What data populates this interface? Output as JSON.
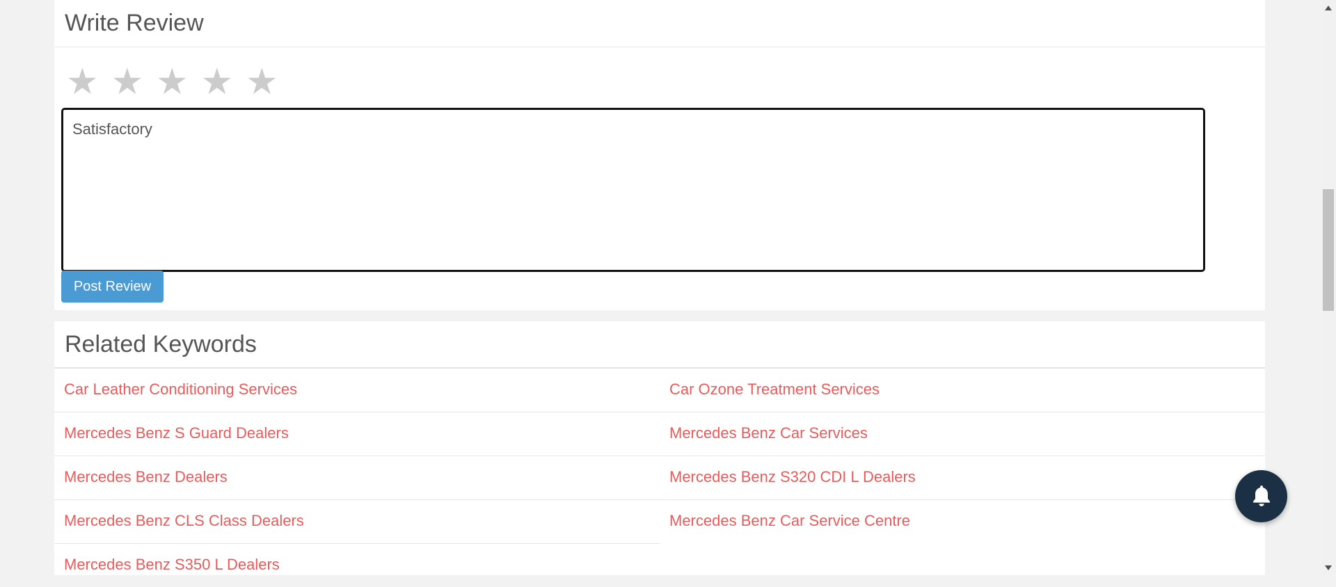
{
  "review": {
    "title": "Write Review",
    "rating": 0,
    "max_rating": 5,
    "star_glyph": "★",
    "text_placeholder": "Satisfactory",
    "post_label": "Post Review"
  },
  "keywords": {
    "title": "Related Keywords",
    "items": [
      "Car Leather Conditioning Services",
      "Car Ozone Treatment Services",
      "Mercedes Benz S Guard Dealers",
      "Mercedes Benz Car Services",
      "Mercedes Benz Dealers",
      "Mercedes Benz S320 CDI L Dealers",
      "Mercedes Benz CLS Class Dealers",
      "Mercedes Benz Car Service Centre",
      "Mercedes Benz S350 L Dealers"
    ]
  },
  "fab": {
    "icon": "bell-icon"
  },
  "colors": {
    "link": "#e95b5b",
    "button": "#4a9ad4",
    "fab": "#1b3044",
    "star_empty": "#cccccc"
  }
}
